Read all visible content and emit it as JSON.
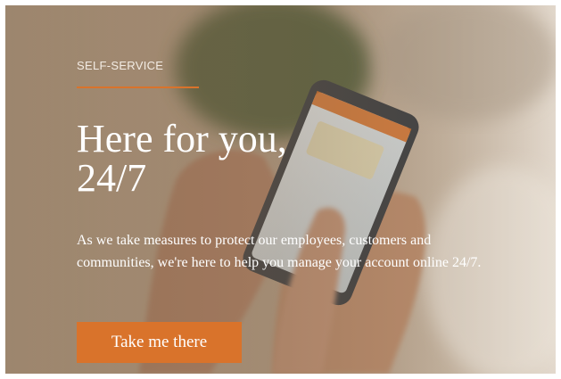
{
  "hero": {
    "eyebrow": "SELF-SERVICE",
    "headline_line1": "Here for you,",
    "headline_line2": "24/7",
    "body": "As we take measures to protect our employees, customers and communities, we're here to help you manage your account online 24/7.",
    "cta_label": "Take me there"
  },
  "colors": {
    "accent": "#d9732b",
    "text": "#ffffff"
  }
}
